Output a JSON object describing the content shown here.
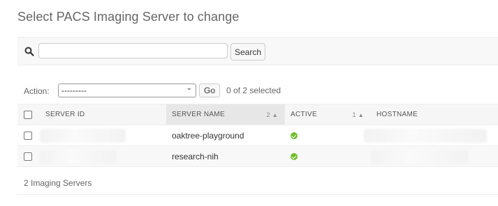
{
  "page": {
    "title": "Select PACS Imaging Server to change"
  },
  "search": {
    "value": "",
    "placeholder": "",
    "button_label": "Search"
  },
  "actions": {
    "label": "Action:",
    "selected_option": "---------",
    "go_label": "Go",
    "selection_count": "0 of 2 selected"
  },
  "table": {
    "headers": {
      "server_id": "Server ID",
      "server_name": "Server Name",
      "server_name_sort_priority": "2",
      "active": "Active",
      "active_sort_priority": "1",
      "hostname": "Hostname"
    },
    "rows": [
      {
        "server_id": "",
        "server_name": "oaktree-playground",
        "active": true,
        "hostname": ""
      },
      {
        "server_id": "",
        "server_name": "research-nih",
        "active": true,
        "hostname": ""
      }
    ]
  },
  "footer": {
    "count_text": "2 Imaging Servers"
  },
  "colors": {
    "active_check": "#70bf2b",
    "header_bg": "#f6f6f6",
    "sorted_header_bg": "#e7e7e7"
  }
}
